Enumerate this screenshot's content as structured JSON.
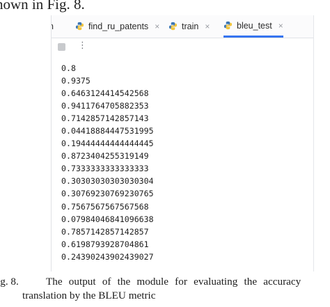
{
  "document": {
    "top_caption": "hown in Fig. 8.",
    "figure_label": "ig. 8.",
    "caption_line1": "The output of the module for evaluating the accuracy",
    "caption_line2": "translation by the BLEU metric"
  },
  "ide": {
    "tabs": [
      {
        "label": "n",
        "icon": "python-icon",
        "closable": false,
        "active": false
      },
      {
        "label": "find_ru_patents",
        "icon": "python-icon",
        "close_glyph": "×",
        "active": false
      },
      {
        "label": "train",
        "icon": "python-icon",
        "close_glyph": "×",
        "active": false
      },
      {
        "label": "bleu_test",
        "icon": "python-icon",
        "close_glyph": "×",
        "active": true
      }
    ],
    "toolbar": {
      "stop_icon": "stop-square-icon",
      "more_icon": "more-vertical-icon",
      "more_glyph": "⋮"
    },
    "console_output": [
      "0.8",
      "0.9375",
      "0.6463124414542568",
      "0.9411764705882353",
      "0.7142857142857143",
      "0.04418884447531995",
      "0.19444444444444445",
      "0.8723404255319149",
      "0.7333333333333333",
      "0.30303030303030304",
      "0.30769230769230765",
      "0.7567567567567568",
      "0.07984046841096638",
      "0.7857142857142857",
      "0.6198793928704861",
      "0.24390243902439027"
    ],
    "colors": {
      "active_tab_underline": "#3574f0",
      "python_icon_blue": "#3b76b5",
      "python_icon_yellow": "#f2c53d"
    }
  }
}
